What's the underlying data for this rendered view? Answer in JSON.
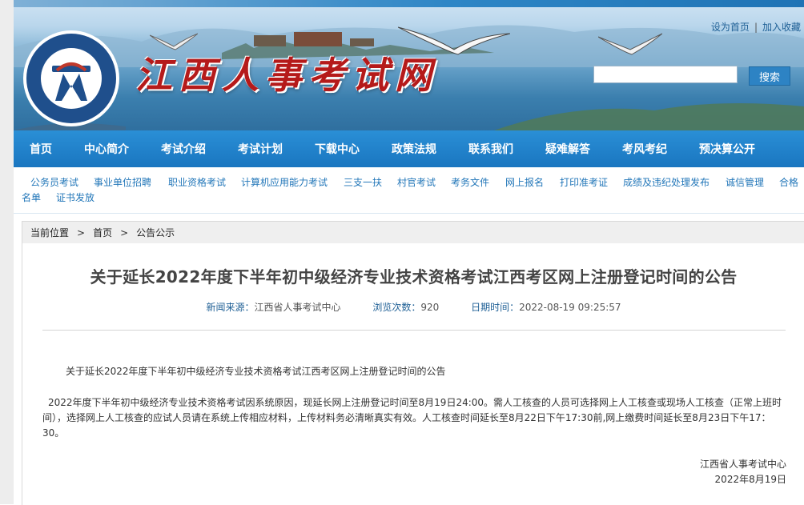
{
  "header": {
    "site_title": "江西人事考试网",
    "logo_text": "江西省人事考试中心",
    "top_links": {
      "set_home": "设为首页",
      "separator": "|",
      "add_favorite": "加入收藏"
    },
    "search": {
      "value": "",
      "placeholder": "",
      "button_label": "搜索"
    }
  },
  "main_nav": {
    "items": [
      "首页",
      "中心简介",
      "考试介绍",
      "考试计划",
      "下载中心",
      "政策法规",
      "联系我们",
      "疑难解答",
      "考风考纪",
      "预决算公开"
    ]
  },
  "sub_nav": {
    "items": [
      "公务员考试",
      "事业单位招聘",
      "职业资格考试",
      "计算机应用能力考试",
      "三支一扶",
      "村官考试",
      "考务文件",
      "网上报名",
      "打印准考证",
      "成绩及违纪处理发布",
      "诚信管理",
      "合格",
      "名单",
      "证书发放"
    ]
  },
  "breadcrumb": {
    "label": "当前位置",
    "arrow": ">",
    "home": "首页",
    "current": "公告公示"
  },
  "article": {
    "title": "关于延长2022年度下半年初中级经济专业技术资格考试江西考区网上注册登记时间的公告",
    "meta": {
      "source_label": "新闻来源：",
      "source_value": "江西省人事考试中心",
      "views_label": "浏览次数：",
      "views_value": "920",
      "date_label": "日期时间：",
      "date_value": "2022-08-19 09:25:57"
    },
    "heading_line": "关于延长2022年度下半年初中级经济专业技术资格考试江西考区网上注册登记时间的公告",
    "paragraph": "2022年度下半年初中级经济专业技术资格考试因系统原因，现延长网上注册登记时间至8月19日24:00。需人工核查的人员可选择网上人工核查或现场人工核查（正常上班时间），选择网上人工核查的应试人员请在系统上传相应材料，上传材料务必清晰真实有效。人工核查时间延长至8月22日下午17:30前,网上缴费时间延长至8月23日下午17：30。",
    "signature_org": "江西省人事考试中心",
    "signature_date": "2022年8月19日"
  },
  "colors": {
    "nav_bg": "#1a76c0",
    "sub_nav_link": "#2377b9",
    "title_red": "#b51a1a",
    "search_button": "#2d83c4"
  }
}
